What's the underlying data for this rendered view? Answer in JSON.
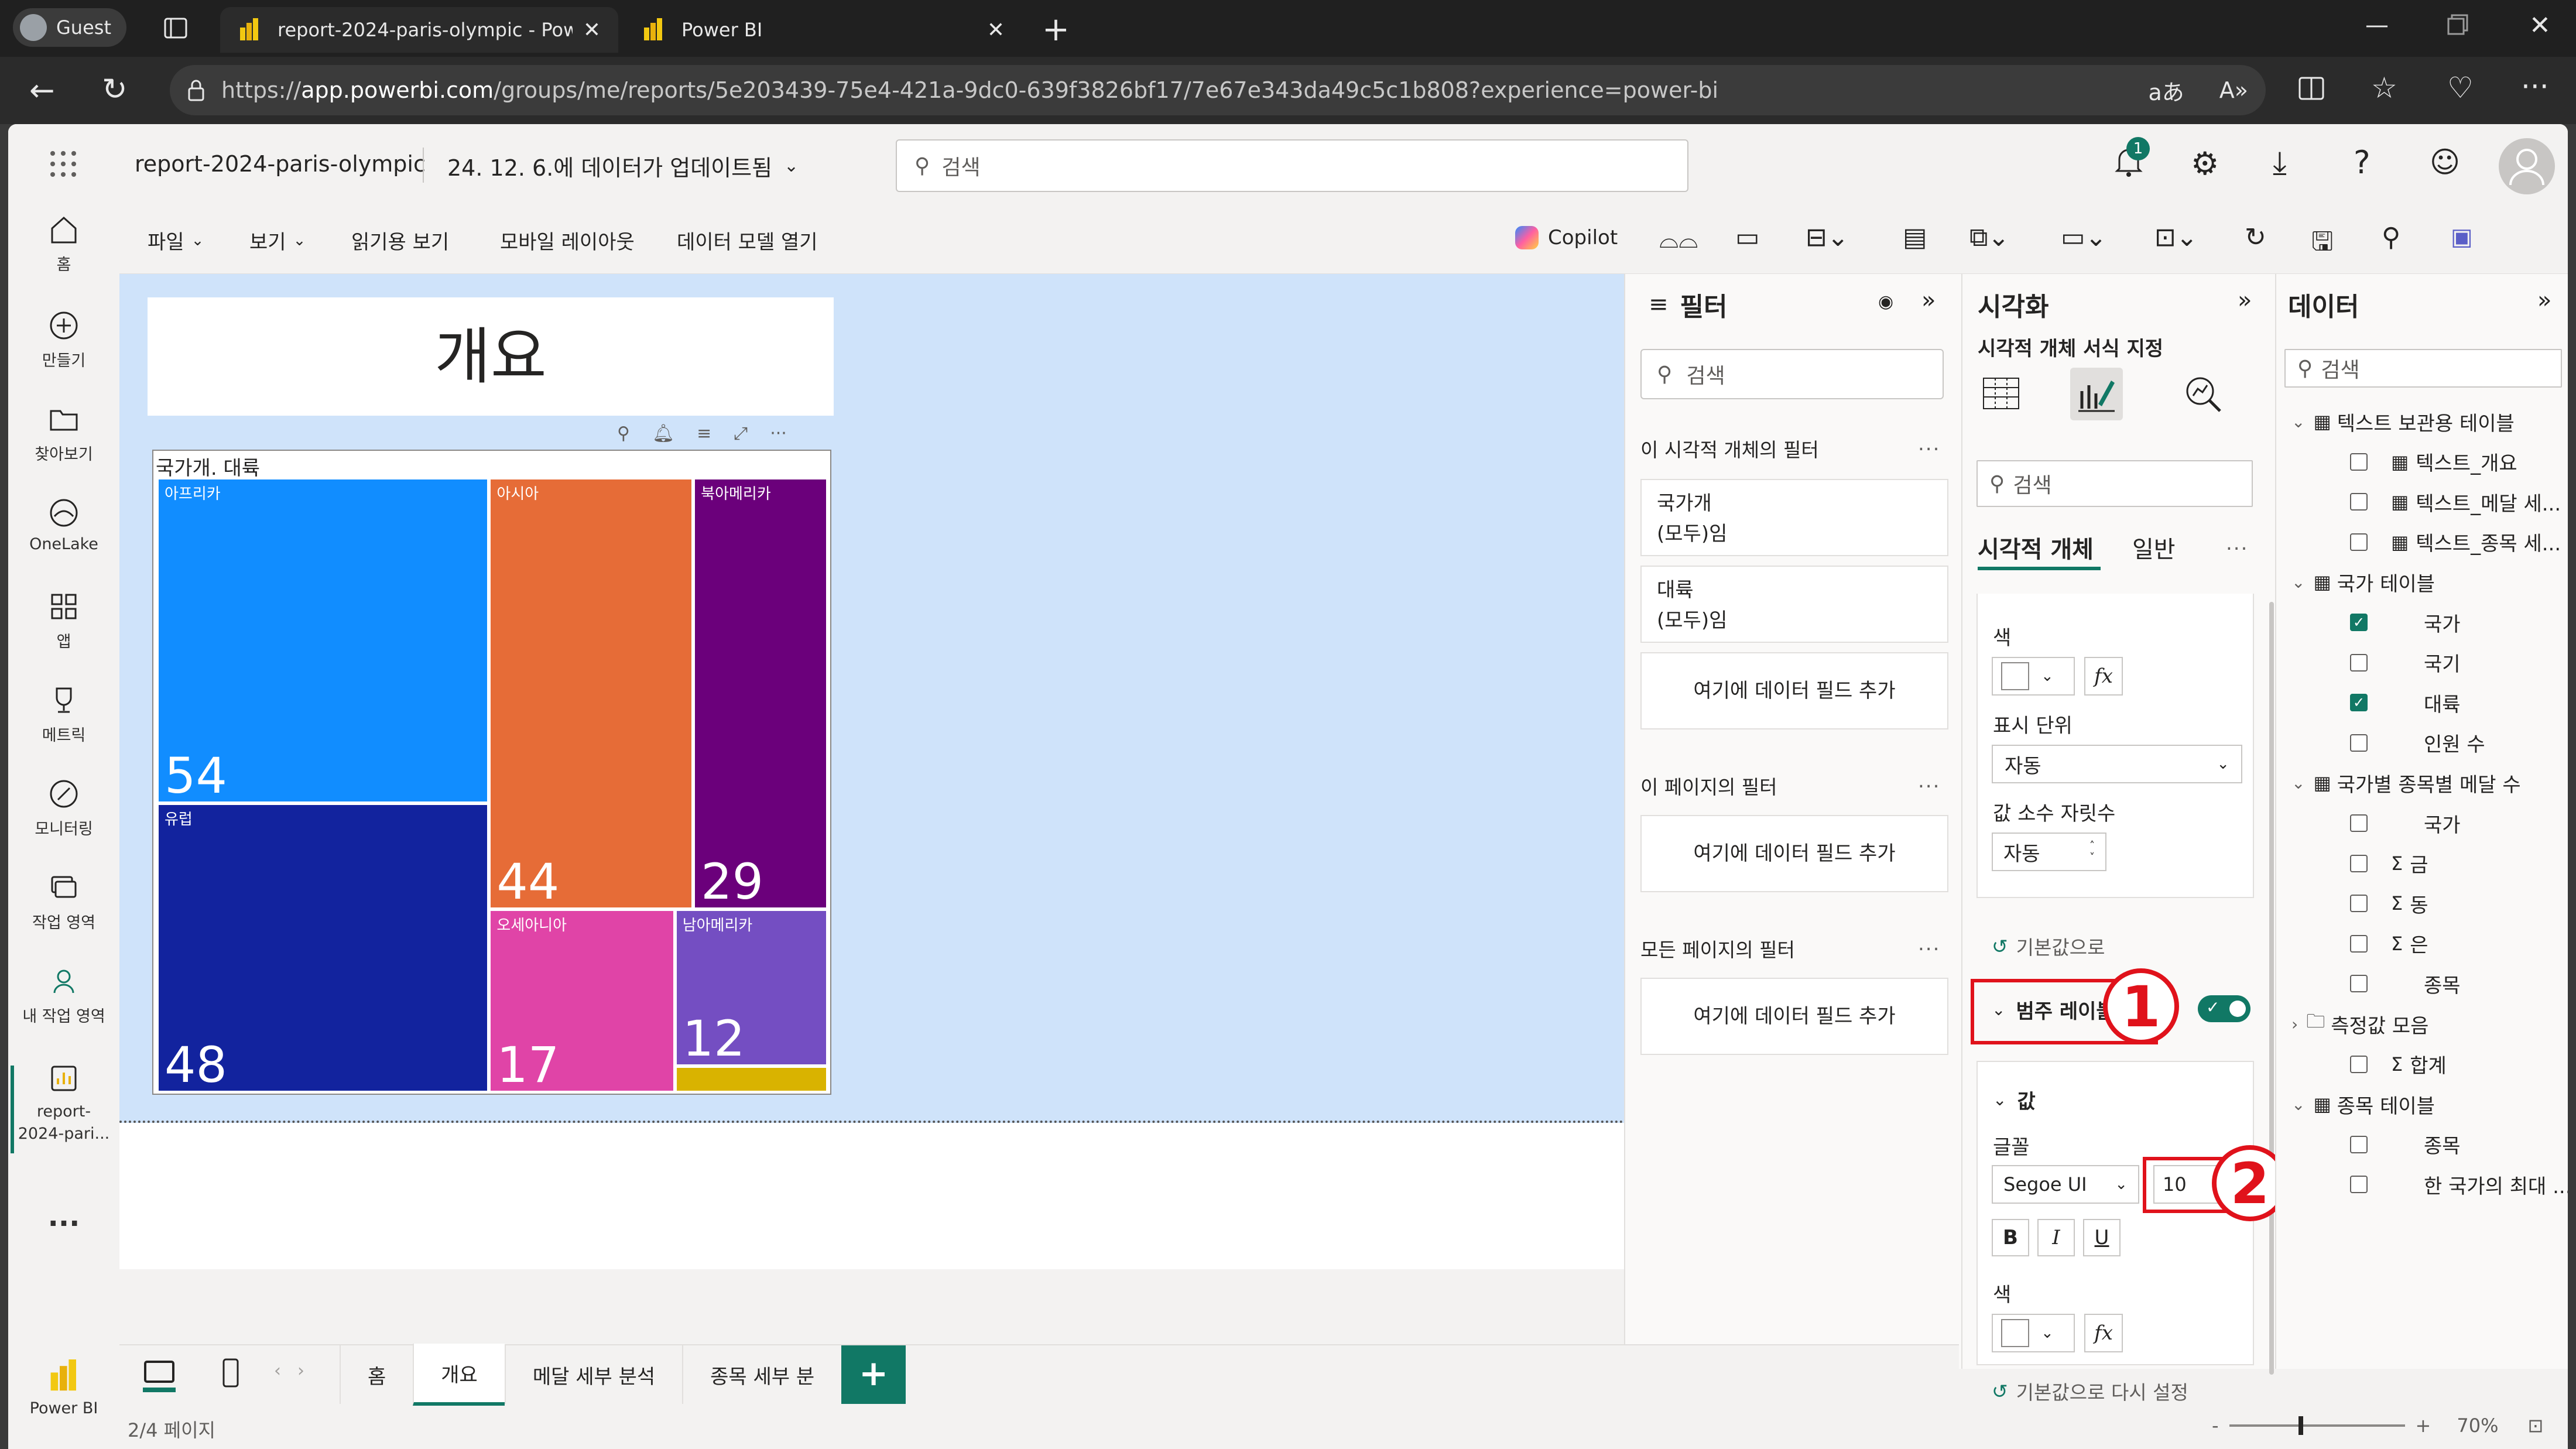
{
  "browser": {
    "profile_label": "Guest",
    "tabs": [
      {
        "title": "report-2024-paris-olympic - Powe"
      },
      {
        "title": "Power BI"
      }
    ],
    "url_prefix": "https://",
    "url_host": "app.powerbi.com",
    "url_path": "/groups/me/reports/5e203439-75e4-421a-9dc0-639f3826bf17/7e67e343da49c5c1b808?experience=power-bi"
  },
  "header": {
    "report_name": "report-2024-paris-olympic",
    "updated_text": "24. 12. 6.에 데이터가 업데이트됨",
    "search_placeholder": "검색",
    "notification_count": "1"
  },
  "leftnav": {
    "items": [
      {
        "label": "홈"
      },
      {
        "label": "만들기"
      },
      {
        "label": "찾아보기"
      },
      {
        "label": "OneLake"
      },
      {
        "label": "앱"
      },
      {
        "label": "메트릭"
      },
      {
        "label": "모니터링"
      },
      {
        "label": "작업 영역"
      },
      {
        "label": "내 작업 영역"
      },
      {
        "label": "report-\n2024-pari..."
      }
    ],
    "more": "...",
    "brand_label": "Power BI"
  },
  "ribbon": {
    "menus": [
      "파일",
      "보기",
      "읽기용 보기",
      "모바일 레이아웃",
      "데이터 모델 열기"
    ],
    "copilot_label": "Copilot"
  },
  "canvas": {
    "title_text": "개요",
    "visual_header": "국가개. 대륙",
    "treemap": [
      {
        "name": "아프리카",
        "value": 54,
        "color": "#118dff"
      },
      {
        "name": "유럽",
        "value": 48,
        "color": "#12239e"
      },
      {
        "name": "아시아",
        "value": 44,
        "color": "#e66c37"
      },
      {
        "name": "북아메리카",
        "value": 29,
        "color": "#6b007b"
      },
      {
        "name": "오세아니아",
        "value": 17,
        "color": "#e044a7"
      },
      {
        "name": "남아메리카",
        "value": 12,
        "color": "#744ec2"
      },
      {
        "name": "",
        "value": 2,
        "color": "#d9b300"
      }
    ]
  },
  "filters": {
    "title": "필터",
    "search_placeholder": "검색",
    "visual_section": "이 시각적 개체의 필터",
    "visual_cards": [
      {
        "field": "국가개",
        "state": "(모두)임"
      },
      {
        "field": "대륙",
        "state": "(모두)임"
      }
    ],
    "add_field": "여기에 데이터 필드 추가",
    "page_section": "이 페이지의 필터",
    "all_section": "모든 페이지의 필터",
    "more": "..."
  },
  "visualizations": {
    "title": "시각화",
    "subtitle": "시각적 개체 서식 지정",
    "search_placeholder": "검색",
    "tabs": [
      "시각적 개체",
      "일반"
    ],
    "more": "...",
    "color_label": "색",
    "display_units_label": "표시 단위",
    "display_units_value": "자동",
    "decimals_label": "값 소수 자릿수",
    "decimals_value": "자동",
    "reset_label": "기본값으로 다시 설정",
    "reset_label_short": "기본값으로",
    "category_label_section": "범주 레이블",
    "values_section": "값",
    "font_label": "글꼴",
    "font_family_value": "Segoe UI",
    "font_size_value": "10",
    "bold": "B",
    "italic": "I",
    "underline": "U",
    "fx": "fx",
    "color2_label": "색",
    "reset2_label": "기본값으로 다시 설정",
    "annotations": [
      "1",
      "2"
    ]
  },
  "data_pane": {
    "title": "데이터",
    "search_placeholder": "검색",
    "tree": [
      {
        "kind": "table",
        "label": "텍스트 보관용 테이블"
      },
      {
        "kind": "field",
        "label": "텍스트_개요",
        "checked": false,
        "icon": "table"
      },
      {
        "kind": "field",
        "label": "텍스트_메달 세...",
        "checked": false,
        "icon": "table"
      },
      {
        "kind": "field",
        "label": "텍스트_종목 세...",
        "checked": false,
        "icon": "table"
      },
      {
        "kind": "table",
        "label": "국가 테이블"
      },
      {
        "kind": "field",
        "label": "국가",
        "checked": true,
        "icon": ""
      },
      {
        "kind": "field",
        "label": "국기",
        "checked": false,
        "icon": ""
      },
      {
        "kind": "field",
        "label": "대륙",
        "checked": true,
        "icon": ""
      },
      {
        "kind": "field",
        "label": "인원 수",
        "checked": false,
        "icon": ""
      },
      {
        "kind": "table",
        "label": "국가별 종목별 메달 수"
      },
      {
        "kind": "field",
        "label": "국가",
        "checked": false,
        "icon": ""
      },
      {
        "kind": "field",
        "label": "금",
        "checked": false,
        "icon": "sigma"
      },
      {
        "kind": "field",
        "label": "동",
        "checked": false,
        "icon": "sigma"
      },
      {
        "kind": "field",
        "label": "은",
        "checked": false,
        "icon": "sigma"
      },
      {
        "kind": "field",
        "label": "종목",
        "checked": false,
        "icon": ""
      },
      {
        "kind": "folder",
        "label": "측정값 모음"
      },
      {
        "kind": "field",
        "label": "합계",
        "checked": false,
        "icon": "sigma"
      },
      {
        "kind": "table",
        "label": "종목 테이블"
      },
      {
        "kind": "field",
        "label": "종목",
        "checked": false,
        "icon": ""
      },
      {
        "kind": "field",
        "label": "한 국가의 최대 ...",
        "checked": false,
        "icon": ""
      }
    ]
  },
  "pages": {
    "tabs": [
      "홈",
      "개요",
      "메달 세부 분석",
      "종목 세부 분"
    ],
    "active_index": 1,
    "add": "+",
    "page_indicator": "2/4 페이지",
    "zoom": "70%"
  }
}
